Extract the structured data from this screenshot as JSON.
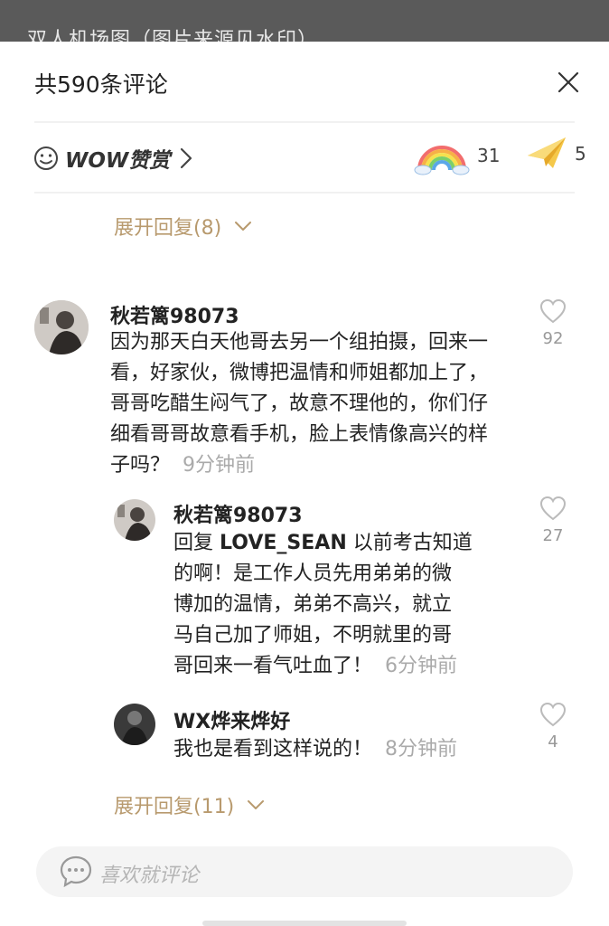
{
  "background_caption": "双人机场图（图片来源见水印）",
  "header": {
    "title": "共590条评论"
  },
  "wow": {
    "label": "WOW赞赏"
  },
  "reactions": [
    {
      "icon": "rainbow-icon",
      "count": "31"
    },
    {
      "icon": "paper-plane-icon",
      "count": "5"
    }
  ],
  "expand_top": {
    "label": "展开回复(8)"
  },
  "comments": [
    {
      "username": "秋若篱98073",
      "lines": [
        "因为那天白天他哥去另一个组拍摄，回来一",
        "看，好家伙，微博把温情和师姐都加上了，",
        "哥哥吃醋生闷气了，故意不理他的，你们仔",
        "细看哥哥故意看手机，脸上表情像高兴的样",
        "子吗？"
      ],
      "time": "9分钟前",
      "likes": "92"
    }
  ],
  "replies": [
    {
      "username": "秋若篱98073",
      "reply_prefix": "回复",
      "reply_to": "LOVE_SEAN",
      "lines": [
        "以前考古知道",
        "的啊！是工作人员先用弟弟的微",
        "博加的温情，弟弟不高兴，就立",
        "马自己加了师姐，不明就里的哥",
        "哥回来一看气吐血了！"
      ],
      "time": "6分钟前",
      "likes": "27"
    },
    {
      "username": "WX烨来烨好",
      "lines": [
        "我也是看到这样说的！"
      ],
      "time": "8分钟前",
      "likes": "4"
    }
  ],
  "expand_bottom": {
    "label": "展开回复(11)"
  },
  "input": {
    "placeholder": "喜欢就评论"
  }
}
